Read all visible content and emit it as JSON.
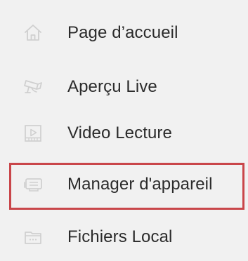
{
  "menu": {
    "items": [
      {
        "label": "Page d’accueil",
        "icon": "home-icon"
      },
      {
        "label": "Aperçu Live",
        "icon": "camera-icon"
      },
      {
        "label": "Video Lecture",
        "icon": "video-playback-icon"
      },
      {
        "label": "Manager d'appareil",
        "icon": "device-manager-icon",
        "highlighted": true
      },
      {
        "label": "Fichiers Local",
        "icon": "folder-icon"
      }
    ]
  },
  "colors": {
    "background": "#f1f1f1",
    "text": "#2b2b2b",
    "icon": "#cfcfcf",
    "highlight_border": "#c9464a"
  }
}
